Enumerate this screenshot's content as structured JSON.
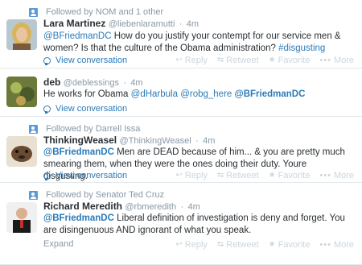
{
  "actions": {
    "reply": "Reply",
    "retweet": "Retweet",
    "favorite": "Favorite",
    "more": "More"
  },
  "colors": {
    "link": "#2b7bb9",
    "muted": "#8899a6",
    "action": "#ccd6dd"
  },
  "tweets": [
    {
      "context": "Followed by NOM and 1 other",
      "fullname": "Lara Martinez",
      "handle": "@liebenlaramutti",
      "time": "4m",
      "mention": "@BFriedmanDC",
      "text": " How do you justify your contempt for our service men & women? Is that the culture of the Obama administration? ",
      "hashtag": "#disgusting",
      "view_conversation": "View conversation"
    },
    {
      "fullname": "deb",
      "handle": "@deblessings",
      "time": "4m",
      "text_start": "He works for Obama ",
      "mention1": "@dHarbula",
      "mention2": "@robg_here",
      "mention3": "@BFriedmanDC",
      "view_conversation": "View conversation"
    },
    {
      "context": "Followed by Darrell Issa",
      "fullname": "ThinkingWeasel",
      "handle": "@ThinkingWeasel",
      "time": "4m",
      "mention": "@BFriedmanDC",
      "text": " Men are DEAD because of him... & you are pretty much smearing them, when they were the ones doing their duty. Youre disgusting.",
      "view_conversation": "View conversation"
    },
    {
      "context": "Followed by Senator Ted Cruz",
      "fullname": "Richard Meredith",
      "handle": "@rbmeredith",
      "time": "4m",
      "mention": "@BFriedmanDC",
      "text": " Liberal definition of investigation is deny and forget. You are disingenuous AND ignorant of what you speak.",
      "expand": "Expand"
    }
  ]
}
